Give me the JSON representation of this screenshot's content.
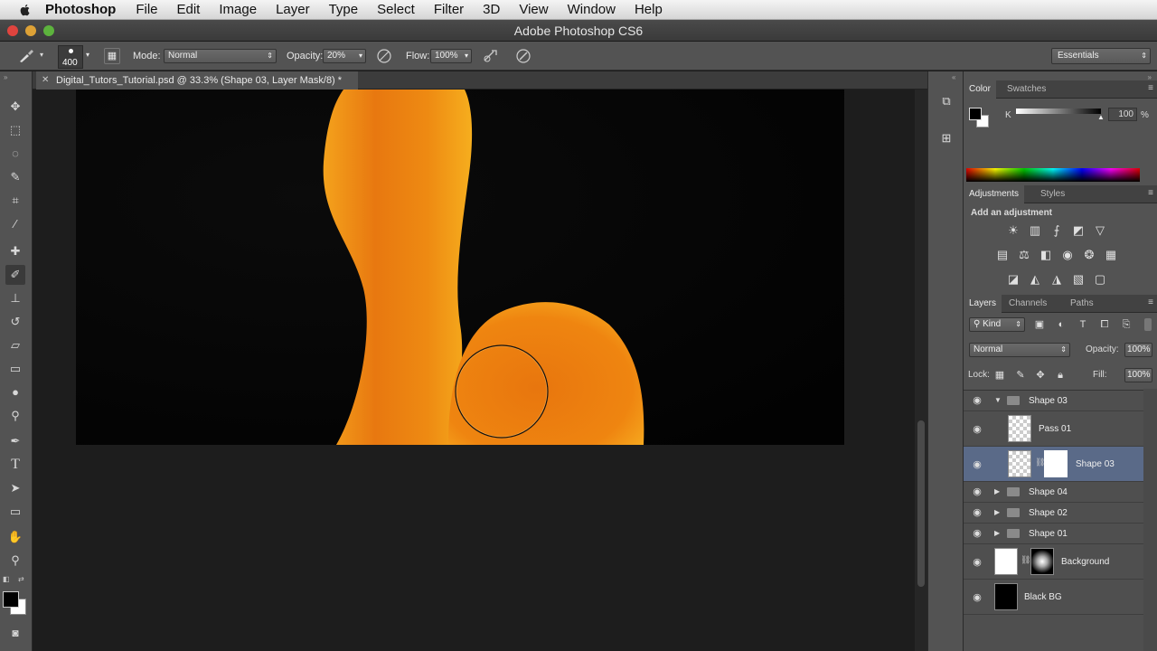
{
  "menubar": {
    "app": "Photoshop",
    "items": [
      "File",
      "Edit",
      "Image",
      "Layer",
      "Type",
      "Select",
      "Filter",
      "3D",
      "View",
      "Window",
      "Help"
    ]
  },
  "window": {
    "title": "Adobe Photoshop CS6"
  },
  "options": {
    "brush_size": "400",
    "mode_label": "Mode:",
    "mode_value": "Normal",
    "opacity_label": "Opacity:",
    "opacity_value": "20%",
    "flow_label": "Flow:",
    "flow_value": "100%",
    "workspace": "Essentials"
  },
  "document": {
    "tab_title": "Digital_Tutors_Tutorial.psd @ 33.3% (Shape 03, Layer Mask/8) *"
  },
  "color_panel": {
    "tabs": [
      "Color",
      "Swatches"
    ],
    "channel": "K",
    "value": "100",
    "unit": "%"
  },
  "adjustments_panel": {
    "tabs": [
      "Adjustments",
      "Styles"
    ],
    "heading": "Add an adjustment"
  },
  "layers_panel": {
    "tabs": [
      "Layers",
      "Channels",
      "Paths"
    ],
    "kind": "Kind",
    "blend_mode": "Normal",
    "opacity_label": "Opacity:",
    "opacity_value": "100%",
    "lock_label": "Lock:",
    "fill_label": "Fill:",
    "fill_value": "100%",
    "layers": [
      {
        "name": "Shape 03",
        "type": "group-open"
      },
      {
        "name": "Pass 01",
        "type": "layer"
      },
      {
        "name": "Shape 03",
        "type": "layer-mask",
        "selected": true
      },
      {
        "name": "Shape 04",
        "type": "group"
      },
      {
        "name": "Shape 02",
        "type": "group"
      },
      {
        "name": "Shape 01",
        "type": "group"
      },
      {
        "name": "Background",
        "type": "layer-mask"
      },
      {
        "name": "Black BG",
        "type": "layer"
      }
    ]
  },
  "colors": {
    "accent_orange": "#f39a16",
    "selected_layer": "#5a6a88",
    "canvas_bg": "#050505"
  }
}
